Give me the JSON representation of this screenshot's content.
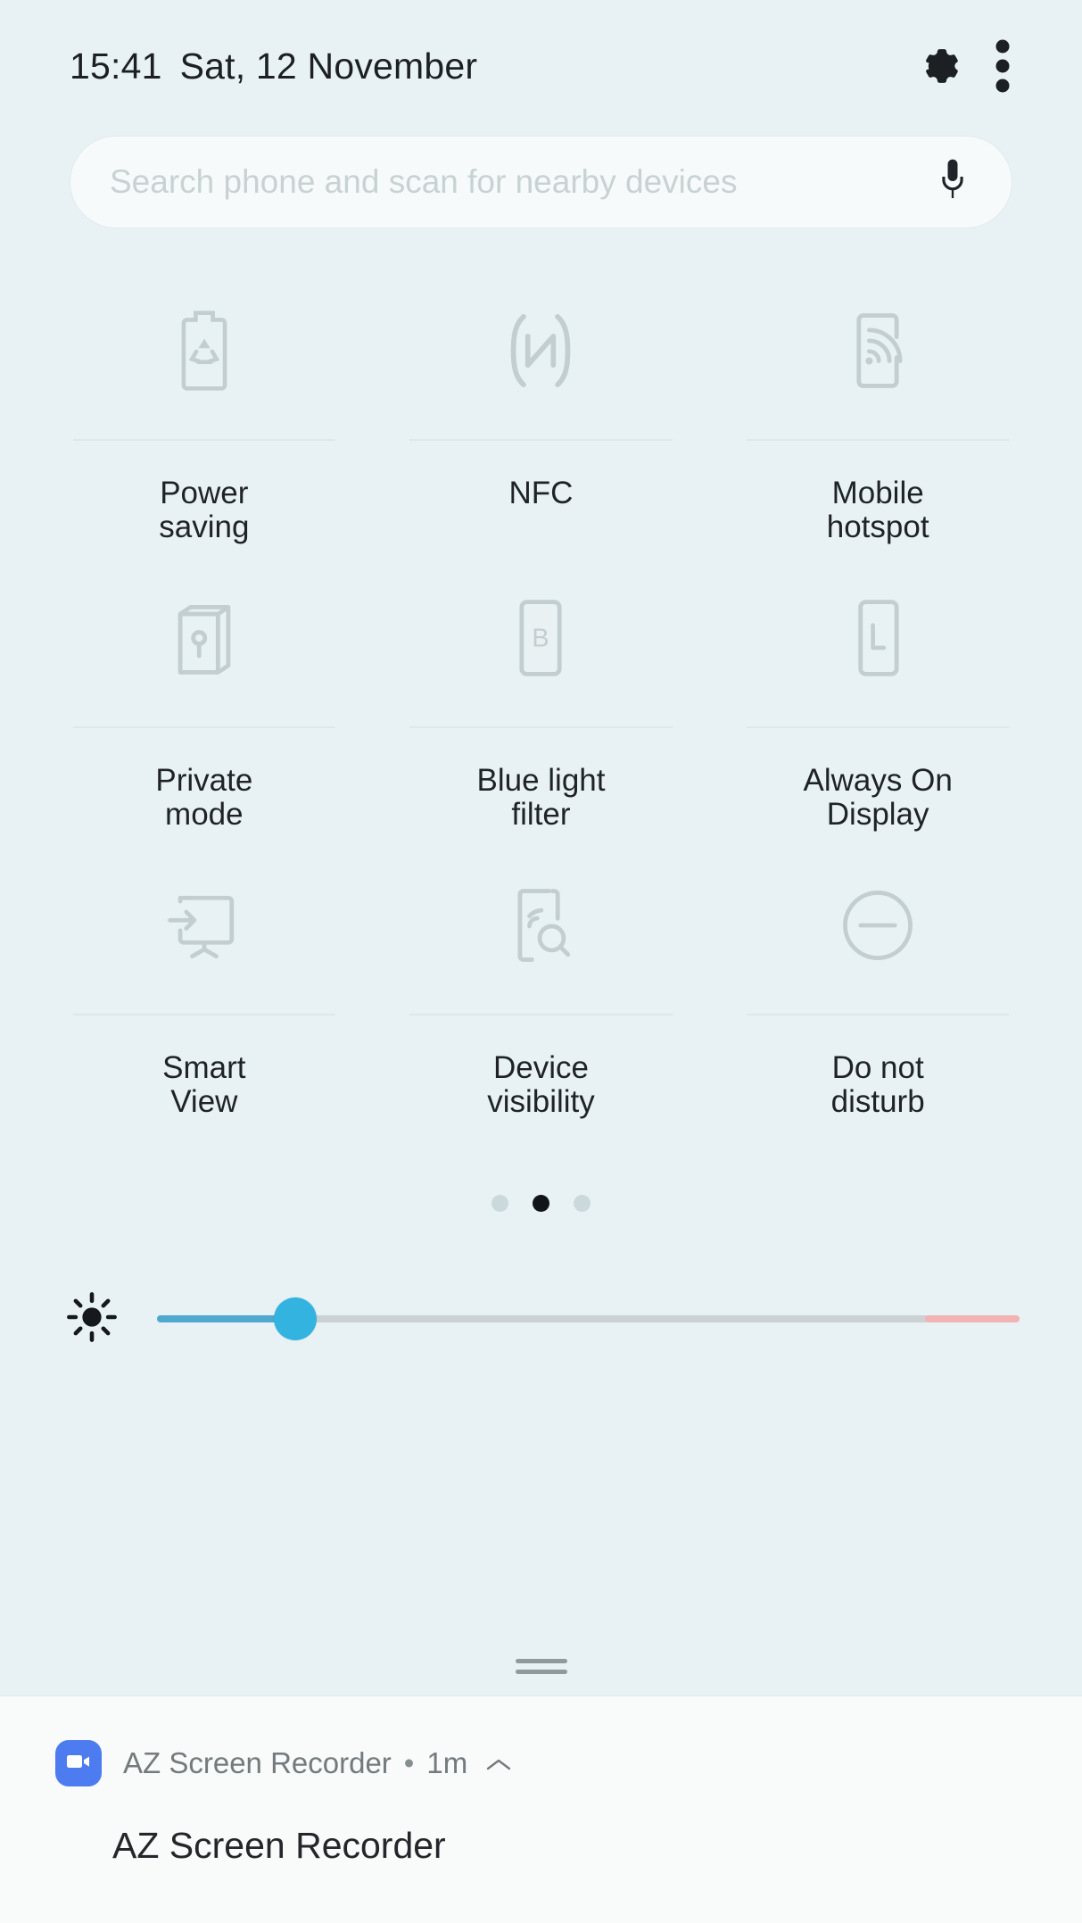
{
  "status_bar": {
    "time": "15:41",
    "date": "Sat, 12 November",
    "settings_icon": "gear-icon",
    "overflow_icon": "three-dot-menu-icon"
  },
  "search": {
    "placeholder": "Search phone and scan for nearby devices",
    "value": "",
    "mic_icon": "microphone-icon"
  },
  "tiles": [
    {
      "label": "Power\nsaving",
      "icon": "power-saving-icon",
      "state": "off"
    },
    {
      "label": "NFC",
      "icon": "nfc-icon",
      "state": "off"
    },
    {
      "label": "Mobile\nhotspot",
      "icon": "mobile-hotspot-icon",
      "state": "off"
    },
    {
      "label": "Private\nmode",
      "icon": "private-mode-icon",
      "state": "off"
    },
    {
      "label": "Blue light\nfilter",
      "icon": "blue-light-filter-icon",
      "state": "off"
    },
    {
      "label": "Always On\nDisplay",
      "icon": "always-on-display-icon",
      "state": "off"
    },
    {
      "label": "Smart\nView",
      "icon": "smart-view-icon",
      "state": "off"
    },
    {
      "label": "Device\nvisibility",
      "icon": "device-visibility-icon",
      "state": "off"
    },
    {
      "label": "Do not\ndisturb",
      "icon": "do-not-disturb-icon",
      "state": "off"
    }
  ],
  "pagination": {
    "pages": 3,
    "active_index": 1
  },
  "brightness": {
    "icon": "brightness-icon",
    "percent": 16,
    "warn_zone_start_percent": 89,
    "fill_color": "#4fa8cf",
    "thumb_color": "#33b3e0",
    "track_color": "#ccd2d3",
    "warn_color": "#f4b3b3"
  },
  "grabber": {
    "name": "panel-grabber-handle"
  },
  "notification": {
    "app_name": "AZ Screen Recorder",
    "separator": "•",
    "time_ago": "1m",
    "expand_icon": "chevron-up-icon",
    "app_icon": "video-camera-icon",
    "app_icon_color": "#4d7cf0",
    "title": "AZ Screen Recorder"
  },
  "colors": {
    "panel_background": "#e8f2f4",
    "notification_background": "#f9fafa",
    "text_primary": "#1f2326",
    "text_secondary": "#737b7d",
    "tile_icon": "#c3ced1",
    "divider": "#dee8ea"
  }
}
